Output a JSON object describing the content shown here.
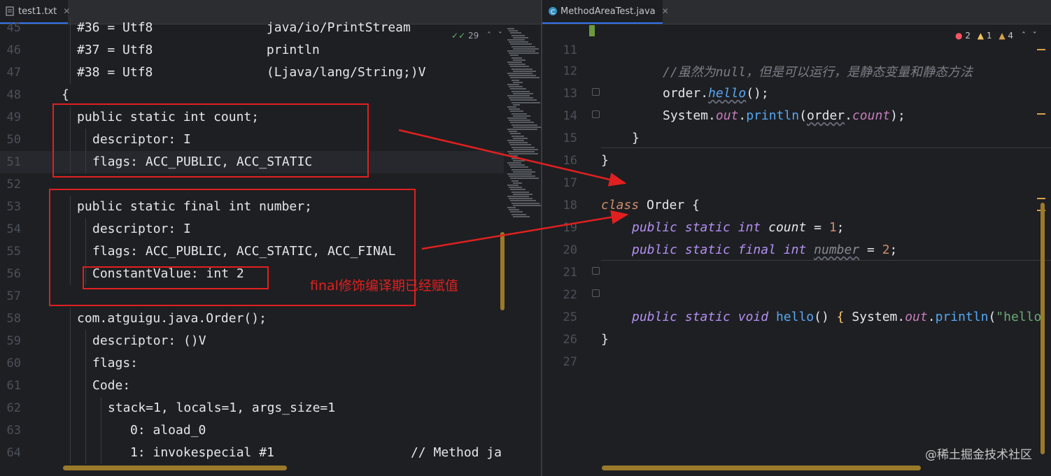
{
  "left_editor": {
    "tab_title": "test1.txt",
    "inspection_count": "29",
    "lines": [
      {
        "n": "45",
        "text": "#36 = Utf8               java/io/PrintStream"
      },
      {
        "n": "46",
        "text": "#37 = Utf8               println"
      },
      {
        "n": "47",
        "text": "#38 = Utf8               (Ljava/lang/String;)V"
      },
      {
        "n": "48",
        "text": "{"
      },
      {
        "n": "49",
        "text": "public static int count;"
      },
      {
        "n": "50",
        "text": "descriptor: I"
      },
      {
        "n": "51",
        "text": "flags: ACC_PUBLIC, ACC_STATIC"
      },
      {
        "n": "52",
        "text": ""
      },
      {
        "n": "53",
        "text": "public static final int number;"
      },
      {
        "n": "54",
        "text": "descriptor: I"
      },
      {
        "n": "55",
        "text": "flags: ACC_PUBLIC, ACC_STATIC, ACC_FINAL"
      },
      {
        "n": "56",
        "text": "ConstantValue: int 2"
      },
      {
        "n": "57",
        "text": ""
      },
      {
        "n": "58",
        "text": "com.atguigu.java.Order();"
      },
      {
        "n": "59",
        "text": "descriptor: ()V"
      },
      {
        "n": "60",
        "text": "flags:"
      },
      {
        "n": "61",
        "text": "Code:"
      },
      {
        "n": "62",
        "text": "stack=1, locals=1, args_size=1"
      },
      {
        "n": "63",
        "text": "0: aload_0"
      },
      {
        "n": "64",
        "text": "1: invokespecial #1                  // Method ja"
      }
    ]
  },
  "right_editor": {
    "tab_title": "MethodAreaTest.java",
    "inspections": {
      "errors": "2",
      "warnings": "1",
      "weak_warnings": "4"
    },
    "line_numbers": [
      "11",
      "12",
      "13",
      "14",
      "15",
      "16",
      "17",
      "18",
      "19",
      "20",
      "21",
      "22",
      "25",
      "26",
      "27"
    ],
    "code": {
      "l11_comment": "//虽然为null，但是可以运行，是静态变量和静态方法",
      "order_var": "order",
      "hello_call": "hello",
      "system": "System",
      "out": "out",
      "println": "println",
      "count_field": "count",
      "class_kw": "class",
      "class_name": "Order",
      "public_kw": "public",
      "static_kw": "static",
      "final_kw": "final",
      "int_kw": "int",
      "void_kw": "void",
      "number_field": "number",
      "value_1": "1",
      "value_2": "2",
      "hello_str": "\"hello"
    }
  },
  "annotation_text": "final修饰编译期已经赋值",
  "watermark": "@稀土掘金技术社区",
  "colors": {
    "annotation_red": "#e02020",
    "editor_bg": "#1e1f22",
    "keyword_purple": "#c77dbb",
    "number_cyan": "#2aacb8"
  }
}
